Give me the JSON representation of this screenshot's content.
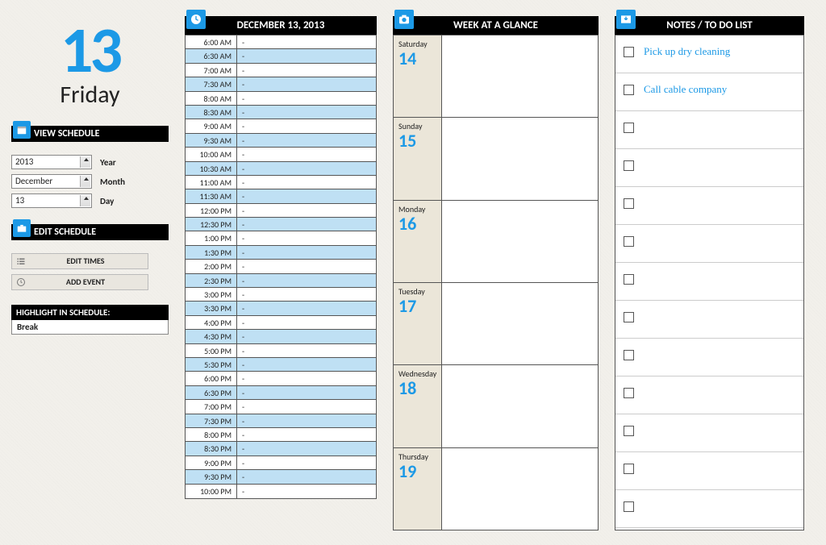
{
  "sidebar": {
    "big_date": "13",
    "weekday": "Friday",
    "view_schedule_label": "VIEW SCHEDULE",
    "year": {
      "value": "2013",
      "label": "Year"
    },
    "month": {
      "value": "December",
      "label": "Month"
    },
    "day": {
      "value": "13",
      "label": "Day"
    },
    "edit_schedule_label": "EDIT SCHEDULE",
    "edit_times_label": "EDIT TIMES",
    "add_event_label": "ADD EVENT",
    "highlight_label": "HIGHLIGHT IN SCHEDULE:",
    "highlight_value": "Break"
  },
  "schedule": {
    "title": "DECEMBER 13, 2013",
    "slots": [
      {
        "t": "6:00 AM",
        "v": "-"
      },
      {
        "t": "6:30 AM",
        "v": "-"
      },
      {
        "t": "7:00 AM",
        "v": "-"
      },
      {
        "t": "7:30 AM",
        "v": "-"
      },
      {
        "t": "8:00 AM",
        "v": "-"
      },
      {
        "t": "8:30 AM",
        "v": "-"
      },
      {
        "t": "9:00 AM",
        "v": "-"
      },
      {
        "t": "9:30 AM",
        "v": "-"
      },
      {
        "t": "10:00 AM",
        "v": "-"
      },
      {
        "t": "10:30 AM",
        "v": "-"
      },
      {
        "t": "11:00 AM",
        "v": "-"
      },
      {
        "t": "11:30 AM",
        "v": "-"
      },
      {
        "t": "12:00 PM",
        "v": "-"
      },
      {
        "t": "12:30 PM",
        "v": "-"
      },
      {
        "t": "1:00 PM",
        "v": "-"
      },
      {
        "t": "1:30 PM",
        "v": "-"
      },
      {
        "t": "2:00 PM",
        "v": "-"
      },
      {
        "t": "2:30 PM",
        "v": "-"
      },
      {
        "t": "3:00 PM",
        "v": "-"
      },
      {
        "t": "3:30 PM",
        "v": "-"
      },
      {
        "t": "4:00 PM",
        "v": "-"
      },
      {
        "t": "4:30 PM",
        "v": "-"
      },
      {
        "t": "5:00 PM",
        "v": "-"
      },
      {
        "t": "5:30 PM",
        "v": "-"
      },
      {
        "t": "6:00 PM",
        "v": "-"
      },
      {
        "t": "6:30 PM",
        "v": "-"
      },
      {
        "t": "7:00 PM",
        "v": "-"
      },
      {
        "t": "7:30 PM",
        "v": "-"
      },
      {
        "t": "8:00 PM",
        "v": "-"
      },
      {
        "t": "8:30 PM",
        "v": "-"
      },
      {
        "t": "9:00 PM",
        "v": "-"
      },
      {
        "t": "9:30 PM",
        "v": "-"
      },
      {
        "t": "10:00 PM",
        "v": "-"
      }
    ]
  },
  "glance": {
    "title": "WEEK AT A GLANCE",
    "days": [
      {
        "name": "Saturday",
        "num": "14"
      },
      {
        "name": "Sunday",
        "num": "15"
      },
      {
        "name": "Monday",
        "num": "16"
      },
      {
        "name": "Tuesday",
        "num": "17"
      },
      {
        "name": "Wednesday",
        "num": "18"
      },
      {
        "name": "Thursday",
        "num": "19"
      }
    ]
  },
  "notes": {
    "title": "NOTES / TO DO LIST",
    "items": [
      {
        "text": "Pick up dry cleaning",
        "checked": false
      },
      {
        "text": "Call cable company",
        "checked": false
      },
      {
        "text": "",
        "checked": false
      },
      {
        "text": "",
        "checked": false
      },
      {
        "text": "",
        "checked": false
      },
      {
        "text": "",
        "checked": false
      },
      {
        "text": "",
        "checked": false
      },
      {
        "text": "",
        "checked": false
      },
      {
        "text": "",
        "checked": false
      },
      {
        "text": "",
        "checked": false
      },
      {
        "text": "",
        "checked": false
      },
      {
        "text": "",
        "checked": false
      },
      {
        "text": "",
        "checked": false
      }
    ]
  }
}
